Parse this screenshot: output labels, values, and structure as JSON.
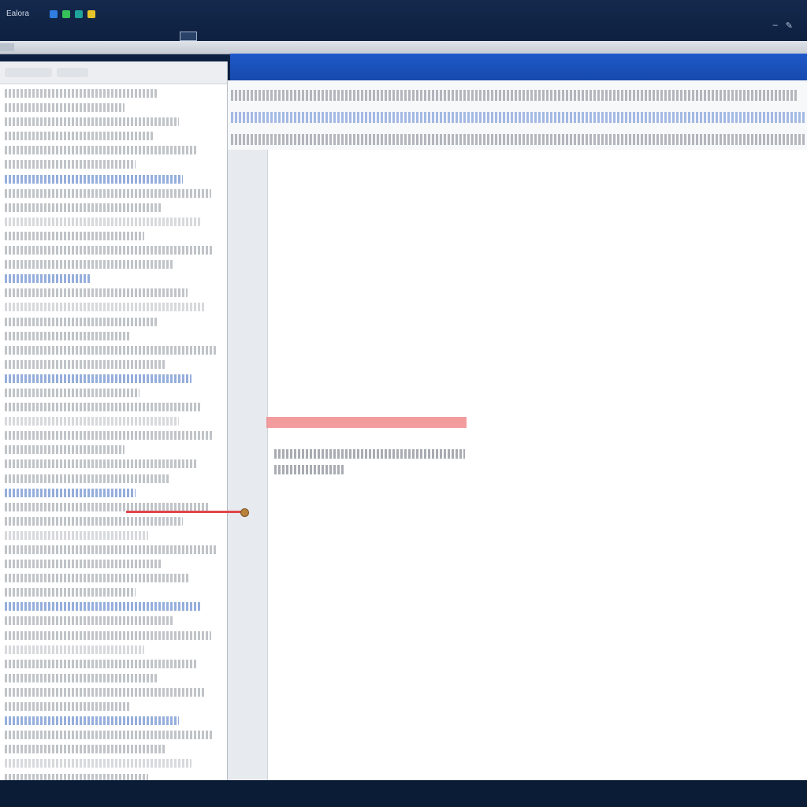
{
  "app": {
    "tray_label": "Ealora"
  },
  "tray_icons": [
    {
      "name": "tray-icon-blue",
      "color": "#2f7de0"
    },
    {
      "name": "tray-icon-green",
      "color": "#36c25a"
    },
    {
      "name": "tray-icon-teal",
      "color": "#1fa49a"
    },
    {
      "name": "tray-icon-yellow",
      "color": "#e5c32a"
    }
  ],
  "colors": {
    "accent_blue": "#1f58c9",
    "highlight_red": "#f08b8d",
    "connector_red": "#e0464a"
  }
}
